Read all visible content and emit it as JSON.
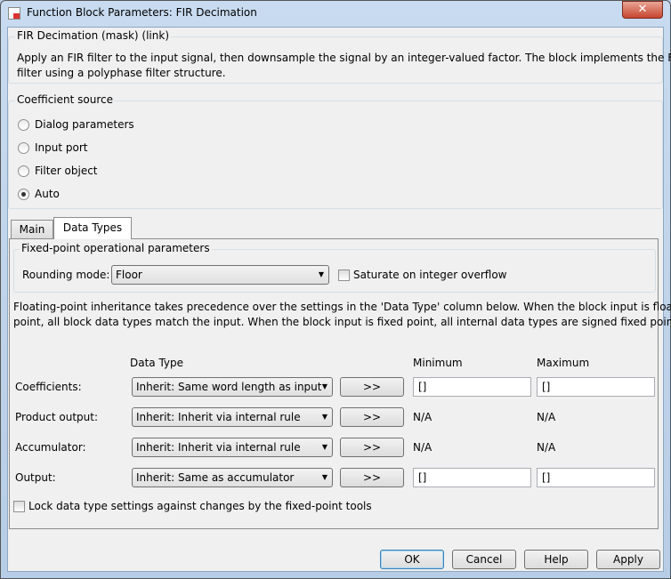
{
  "window": {
    "title": "Function Block Parameters: FIR Decimation",
    "close": "✕"
  },
  "mask": {
    "title": "FIR Decimation (mask) (link)",
    "desc1": "Apply an FIR filter to the input signal, then downsample the signal by an integer-valued factor. The block implements the FIR",
    "desc2": "filter using a polyphase filter structure."
  },
  "coef": {
    "title": "Coefficient source",
    "options": [
      "Dialog parameters",
      "Input port",
      "Filter object",
      "Auto"
    ],
    "selected": "Auto"
  },
  "tabs": [
    "Main",
    "Data Types"
  ],
  "fixed": {
    "title": "Fixed-point operational parameters",
    "rounding_label": "Rounding mode:",
    "rounding_value": "Floor",
    "saturate_label": "Saturate on integer overflow",
    "saturate_checked": false
  },
  "note1": "Floating-point inheritance takes precedence over the settings in the 'Data Type' column below. When the block input is floating",
  "note2": "point, all block data types match the input. When the block input is fixed point, all internal data types are signed fixed point.",
  "table": {
    "headers": {
      "dtype": "Data Type",
      "min": "Minimum",
      "max": "Maximum"
    },
    "rows": [
      {
        "label": "Coefficients:",
        "dtype": "Inherit: Same word length as input",
        "btn": ">>",
        "min": "[]",
        "max": "[]"
      },
      {
        "label": "Product output:",
        "dtype": "Inherit: Inherit via internal rule",
        "btn": ">>",
        "min": "N/A",
        "max": "N/A"
      },
      {
        "label": "Accumulator:",
        "dtype": "Inherit: Inherit via internal rule",
        "btn": ">>",
        "min": "N/A",
        "max": "N/A"
      },
      {
        "label": "Output:",
        "dtype": "Inherit: Same as accumulator",
        "btn": ">>",
        "min": "[]",
        "max": "[]"
      }
    ]
  },
  "lock_label": "Lock data type settings against changes by the fixed-point tools",
  "buttons": {
    "ok": "OK",
    "cancel": "Cancel",
    "help": "Help",
    "apply": "Apply"
  }
}
